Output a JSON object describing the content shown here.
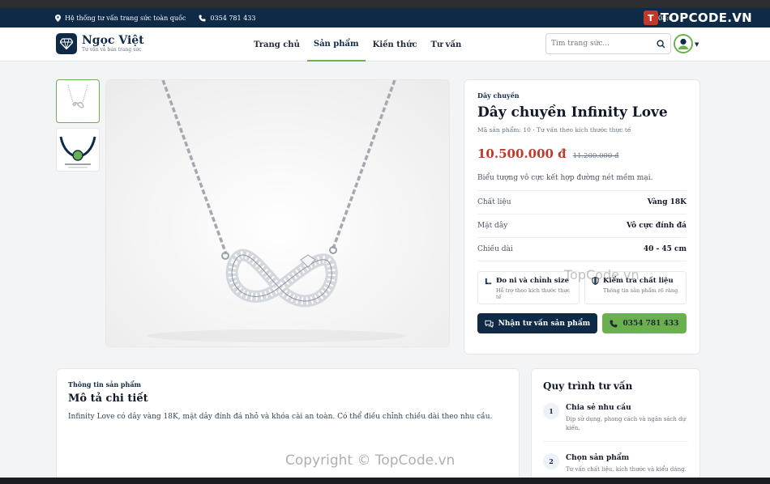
{
  "topbar": {
    "location_text": "Hệ thống tư vấn trang sức toàn quốc",
    "phone_text": "0354 781 433",
    "time_text": "08:0"
  },
  "watermark": {
    "logo_text": "TOPCODE.VN",
    "mid_text": "TopCode.vn",
    "bottom_text": "Copyright © TopCode.vn"
  },
  "brand": {
    "name": "Ngọc Việt",
    "tagline": "Tư vấn và bán trang sức"
  },
  "nav": {
    "items": [
      {
        "label": "Trang chủ"
      },
      {
        "label": "Sản phẩm"
      },
      {
        "label": "Kiến thức"
      },
      {
        "label": "Tư vấn"
      }
    ],
    "active_index": 1
  },
  "search": {
    "placeholder": "Tìm trang sức..."
  },
  "product": {
    "category": "Dây chuyền",
    "title": "Dây chuyền Infinity Love",
    "meta": "Mã sản phẩm: 10 · Tư vấn theo kích thước thực tế",
    "price": "10.500.000 đ",
    "old_price": "11.200.000 đ",
    "short_desc": "Biểu tượng vô cực kết hợp đường nét mềm mại.",
    "specs": [
      {
        "key": "Chất liệu",
        "value": "Vàng 18K"
      },
      {
        "key": "Mặt dây",
        "value": "Vô cực đính đá"
      },
      {
        "key": "Chiều dài",
        "value": "40 - 45 cm"
      }
    ],
    "features": [
      {
        "title": "Đo ni và chỉnh size",
        "subtitle": "Hỗ trợ theo kích thước thực tế",
        "icon": "ruler-icon"
      },
      {
        "title": "Kiểm tra chất liệu",
        "subtitle": "Thông tin sản phẩm rõ ràng",
        "icon": "shield-icon"
      }
    ],
    "consult_button": "Nhận tư vấn sản phẩm",
    "phone_button": "0354 781 433"
  },
  "description": {
    "section_label": "Thông tin sản phẩm",
    "heading": "Mô tả chi tiết",
    "body": "Infinity Love có dây vàng 18K, mặt dây đính đá nhỏ và khóa cài an toàn. Có thể điều chỉnh chiều dài theo nhu cầu."
  },
  "process": {
    "heading": "Quy trình tư vấn",
    "steps": [
      {
        "num": "1",
        "title": "Chia sẻ nhu cầu",
        "desc": "Dịp sử dụng, phong cách và ngân sách dự kiến."
      },
      {
        "num": "2",
        "title": "Chọn sản phẩm",
        "desc": "Tư vấn chất liệu, kích thước và kiểu dáng."
      }
    ]
  },
  "colors": {
    "navy": "#0e2a47",
    "green": "#6ab04c",
    "price_red": "#c0392b"
  }
}
